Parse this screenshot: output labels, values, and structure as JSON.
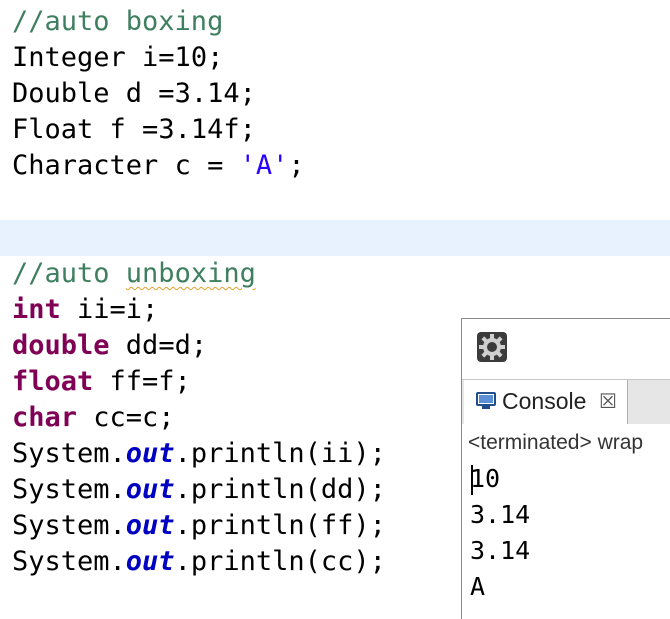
{
  "code": {
    "boxing_comment": "//auto boxing",
    "line_integer": {
      "type": "Integer ",
      "rest": "i=10;"
    },
    "line_double": {
      "type": "Double ",
      "rest": "d =3.14;"
    },
    "line_float": {
      "type": "Float ",
      "rest": "f =3.14f;"
    },
    "line_char": {
      "type": "Character ",
      "mid": "c = ",
      "literal": "'A'",
      "end": ";"
    },
    "unboxing_comment_prefix": "//auto ",
    "unboxing_comment_word": "unboxing",
    "line_int": {
      "kw": "int",
      "rest": " ii=i;"
    },
    "line_dbl": {
      "kw": "double",
      "rest": " dd=d;"
    },
    "line_flt": {
      "kw": "float",
      "rest": " ff=f;"
    },
    "line_chr": {
      "kw": "char",
      "rest": " cc=c;"
    },
    "print_lines": [
      {
        "prefix": "System.",
        "field": "out",
        "suffix": ".println(ii);"
      },
      {
        "prefix": "System.",
        "field": "out",
        "suffix": ".println(dd);"
      },
      {
        "prefix": "System.",
        "field": "out",
        "suffix": ".println(ff);"
      },
      {
        "prefix": "System.",
        "field": "out",
        "suffix": ".println(cc);"
      }
    ]
  },
  "console": {
    "toolbar_icon": "gear-icon",
    "tab_icon": "console-icon",
    "tab_label": "Console",
    "tab_close": "☒",
    "status": "<terminated> wrap",
    "output": [
      "10",
      "3.14",
      "3.14",
      "A"
    ]
  },
  "colors": {
    "comment": "#3f7f5f",
    "keyword": "#7f0055",
    "string": "#2a00ff",
    "field": "#0000c0",
    "current_line": "#e8f2fe"
  }
}
